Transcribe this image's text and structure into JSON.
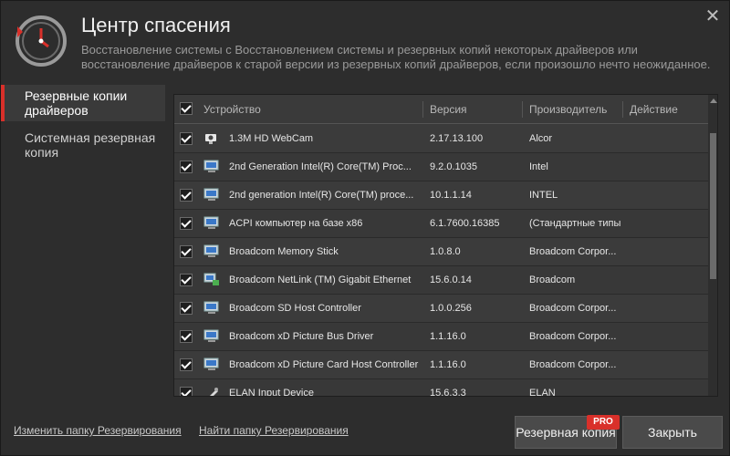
{
  "header": {
    "title": "Центр спасения",
    "subtitle": "Восстановление системы с Восстановлением системы и резервных копий некоторых драйверов или восстановление драйверов к старой версии из резервных копий драйверов, если произошло нечто неожиданное."
  },
  "sidebar": {
    "items": [
      {
        "label": "Резервные копии драйверов"
      },
      {
        "label": "Системная резервная копия"
      }
    ]
  },
  "table": {
    "headers": {
      "device": "Устройство",
      "version": "Версия",
      "vendor": "Производитель",
      "action": "Действие"
    },
    "rows": [
      {
        "device": "1.3M HD WebCam",
        "version": "2.17.13.100",
        "vendor": "Alcor",
        "icon": "webcam-icon"
      },
      {
        "device": "2nd Generation Intel(R) Core(TM) Proc...",
        "version": "9.2.0.1035",
        "vendor": "Intel",
        "icon": "monitor-icon"
      },
      {
        "device": "2nd generation Intel(R) Core(TM) proce...",
        "version": "10.1.1.14",
        "vendor": "INTEL",
        "icon": "monitor-icon"
      },
      {
        "device": "ACPI компьютер на базе x86",
        "version": "6.1.7600.16385",
        "vendor": "(Стандартные типы к...",
        "icon": "monitor-icon"
      },
      {
        "device": "Broadcom Memory Stick",
        "version": "1.0.8.0",
        "vendor": "Broadcom Corpor...",
        "icon": "monitor-icon"
      },
      {
        "device": "Broadcom NetLink (TM) Gigabit Ethernet",
        "version": "15.6.0.14",
        "vendor": "Broadcom",
        "icon": "network-icon"
      },
      {
        "device": "Broadcom SD Host Controller",
        "version": "1.0.0.256",
        "vendor": "Broadcom Corpor...",
        "icon": "monitor-icon"
      },
      {
        "device": "Broadcom xD Picture Bus Driver",
        "version": "1.1.16.0",
        "vendor": "Broadcom Corpor...",
        "icon": "monitor-icon"
      },
      {
        "device": "Broadcom xD Picture Card Host Controller",
        "version": "1.1.16.0",
        "vendor": "Broadcom Corpor...",
        "icon": "monitor-icon"
      },
      {
        "device": "ELAN Input Device",
        "version": "15.6.3.3",
        "vendor": "ELAN",
        "icon": "mouse-icon"
      }
    ]
  },
  "footer": {
    "change_folder": "Изменить папку Резервирования",
    "find_folder": "Найти папку Резервирования",
    "backup_button": "Резервная копия",
    "pro_badge": "PRO",
    "close_button": "Закрыть"
  },
  "colors": {
    "accent": "#d9302a",
    "background": "#2d2d2d",
    "table_bg": "#3a3a3a"
  }
}
